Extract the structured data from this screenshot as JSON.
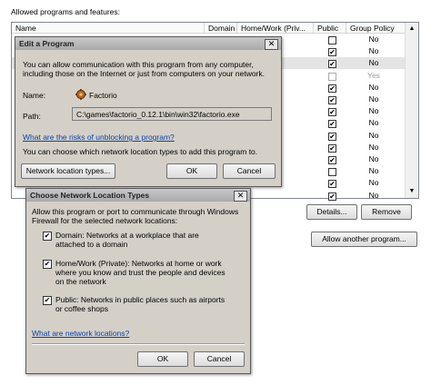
{
  "background": {
    "title": "Allowed programs and features:",
    "columns": [
      "Name",
      "Domain",
      "Home/Work (Priv...",
      "Public",
      "Group Policy"
    ],
    "rows": [
      {
        "public": false,
        "public_grey": false,
        "gp": "No",
        "gp_grey": false
      },
      {
        "public": true,
        "public_grey": false,
        "gp": "No",
        "gp_grey": false
      },
      {
        "public": true,
        "public_grey": false,
        "gp": "No",
        "gp_grey": false,
        "selected": true
      },
      {
        "public": false,
        "public_grey": true,
        "gp": "Yes",
        "gp_grey": true
      },
      {
        "public": true,
        "public_grey": false,
        "gp": "No",
        "gp_grey": false
      },
      {
        "public": true,
        "public_grey": false,
        "gp": "No",
        "gp_grey": false
      },
      {
        "public": true,
        "public_grey": false,
        "gp": "No",
        "gp_grey": false
      },
      {
        "public": true,
        "public_grey": false,
        "gp": "No",
        "gp_grey": false
      },
      {
        "public": true,
        "public_grey": false,
        "gp": "No",
        "gp_grey": false
      },
      {
        "public": true,
        "public_grey": false,
        "gp": "No",
        "gp_grey": false
      },
      {
        "public": true,
        "public_grey": false,
        "gp": "No",
        "gp_grey": false
      },
      {
        "public": false,
        "public_grey": false,
        "gp": "No",
        "gp_grey": false
      },
      {
        "public": true,
        "public_grey": false,
        "gp": "No",
        "gp_grey": false
      },
      {
        "public": true,
        "public_grey": false,
        "gp": "No",
        "gp_grey": false
      }
    ],
    "details_label": "Details...",
    "remove_label": "Remove",
    "allow_another_label": "Allow another program..."
  },
  "edit_dialog": {
    "title": "Edit a Program",
    "description": "You can allow communication with this program from any computer, including those on the Internet or just from computers on your network.",
    "name_label": "Name:",
    "name_value": "Factorio",
    "path_label": "Path:",
    "path_value": "C:\\games\\factorio_0.12.1\\bin\\win32\\factorio.exe",
    "risk_link": "What are the risks of unblocking a program?",
    "choose_text": "You can choose which network location types to add this program to.",
    "network_button": "Network location types...",
    "ok_label": "OK",
    "cancel_label": "Cancel",
    "close_glyph": "✕"
  },
  "location_dialog": {
    "title": "Choose Network Location Types",
    "intro": "Allow this program or port to communicate through Windows Firewall for the selected network locations:",
    "options": [
      {
        "label": "Domain: Networks at a workplace that are attached to a domain",
        "checked": true
      },
      {
        "label": "Home/Work (Private): Networks at home or work where you know and trust the people and devices on the network",
        "checked": true
      },
      {
        "label": "Public: Networks in public places such as airports or coffee shops",
        "checked": true
      }
    ],
    "help_link": "What are network locations?",
    "ok_label": "OK",
    "cancel_label": "Cancel",
    "close_glyph": "✕"
  },
  "colors": {
    "link": "#0645ad",
    "dialog_bg": "#d4d0c8",
    "selection": "#e4e4e4"
  }
}
